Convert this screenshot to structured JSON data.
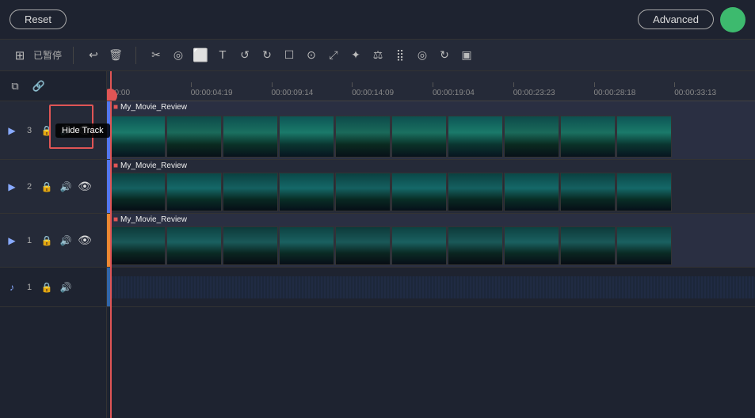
{
  "topBar": {
    "resetLabel": "Reset",
    "advancedLabel": "Advanced"
  },
  "toolbar": {
    "statusText": "已暂停",
    "tools": [
      "↩",
      "🗑",
      "✂",
      "◎",
      "⬜",
      "T+",
      "↺",
      "↻",
      "☐",
      "⊙",
      "⤢",
      "✦",
      "⚖",
      "⣿",
      "◎",
      "↻",
      "▣"
    ]
  },
  "ruler": {
    "marks": [
      "00:00",
      "00:00:04:19",
      "00:00:09:14",
      "00:00:14:09",
      "00:00:19:04",
      "00:00:23:23",
      "00:00:28:18",
      "00:00:33:13"
    ]
  },
  "tracks": [
    {
      "id": "video-3",
      "trackNum": "3",
      "label": "My_Movie_Review",
      "type": "video",
      "visible": true,
      "muted": false,
      "showEyeHighlight": true
    },
    {
      "id": "video-2",
      "trackNum": "2",
      "label": "My_Movie_Review",
      "type": "video",
      "visible": true,
      "muted": false
    },
    {
      "id": "video-1",
      "trackNum": "1",
      "label": "My_Movie_Review",
      "type": "video",
      "visible": true,
      "muted": false
    },
    {
      "id": "audio-1",
      "trackNum": "1",
      "label": "",
      "type": "audio",
      "visible": true,
      "muted": false
    }
  ],
  "tooltip": {
    "hideTrackLabel": "Hide Track"
  },
  "leftPanel": {
    "icons": [
      "copy",
      "link"
    ]
  }
}
